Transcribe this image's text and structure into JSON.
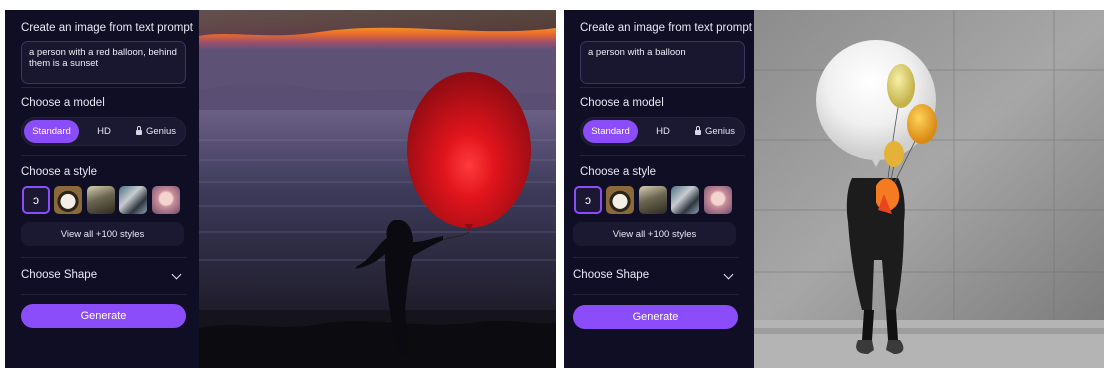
{
  "left_panel": {
    "title": "Create an image from text prompt",
    "prompt": "a person with a red balloon, behind\nthem is a sunset",
    "model_label": "Choose a model",
    "models": [
      "Standard",
      "HD",
      "Genius"
    ],
    "selected_model": "Standard",
    "style_label": "Choose a style",
    "styles": [
      "none-icon",
      "panda-style",
      "forest-style",
      "robot-style",
      "portrait-style"
    ],
    "view_all": "View all +100 styles",
    "shape_label": "Choose Shape",
    "generate": "Generate",
    "image_subject": "sunset-balloon-image"
  },
  "right_panel": {
    "title": "Create an image from text prompt",
    "prompt": "a person with a balloon",
    "model_label": "Choose a model",
    "models": [
      "Standard",
      "HD",
      "Genius"
    ],
    "selected_model": "Standard",
    "style_label": "Choose a style",
    "styles": [
      "none-icon",
      "panda-style",
      "forest-style",
      "robot-style",
      "portrait-style"
    ],
    "view_all": "View all +100 styles",
    "shape_label": "Choose Shape",
    "generate": "Generate",
    "image_subject": "white-balloon-image"
  },
  "colors": {
    "background": "#0f0d24",
    "accent": "#8b4dfa",
    "text": "#e9e7f3"
  }
}
